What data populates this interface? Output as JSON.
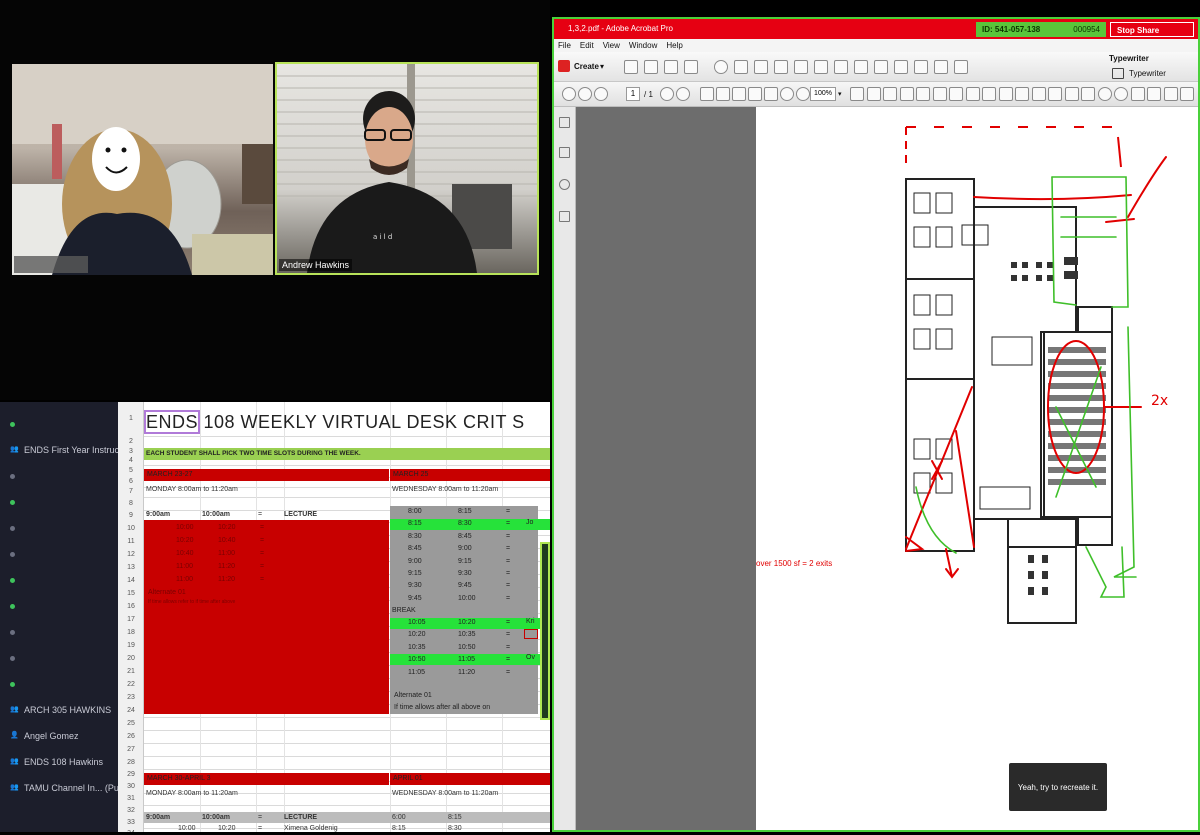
{
  "video": {
    "participants": [
      {
        "name": ""
      },
      {
        "name": "Andrew Hawkins"
      }
    ]
  },
  "sidebar": {
    "items": [
      {
        "label": "",
        "type": "status",
        "dot": "green"
      },
      {
        "label": "ENDS First Year Instructo...",
        "type": "team"
      },
      {
        "label": "",
        "type": "status",
        "dot": "gray"
      },
      {
        "label": "",
        "type": "status",
        "dot": "green"
      },
      {
        "label": "",
        "type": "status",
        "dot": "gray"
      },
      {
        "label": "",
        "type": "status",
        "dot": "gray"
      },
      {
        "label": "",
        "type": "status",
        "dot": "green"
      },
      {
        "label": "",
        "type": "status",
        "dot": "green"
      },
      {
        "label": "",
        "type": "status",
        "dot": "gray"
      },
      {
        "label": "",
        "type": "status",
        "dot": "gray"
      },
      {
        "label": "",
        "type": "status",
        "dot": "green"
      },
      {
        "label": "ARCH 305 HAWKINS",
        "type": "team"
      },
      {
        "label": "Angel Gomez",
        "type": "person"
      },
      {
        "label": "ENDS 108 Hawkins",
        "type": "team"
      },
      {
        "label": "TAMU Channel In... (Public)",
        "type": "team"
      }
    ]
  },
  "sheet": {
    "title": "ENDS 108 WEEKLY VIRTUAL DESK CRIT S",
    "title_sel": "ENDS",
    "subtitle": "EACH STUDENT SHALL PICK TWO TIME SLOTS DURING THE WEEK.",
    "week1_left": "MARCH 23-27",
    "week1_right": "MARCH 25",
    "row6_left": "MONDAY      8:00am to 11:20am",
    "row6_right": "WEDNESDAY 8:00am to 11:20am",
    "row8": {
      "a": "9:00am",
      "b": "10:00am",
      "c": "=",
      "d": "LECTURE"
    },
    "red_times": [
      [
        "10:00",
        "10:20",
        "="
      ],
      [
        "10:20",
        "10:40",
        "="
      ],
      [
        "10:40",
        "11:00",
        "="
      ],
      [
        "11:00",
        "11:20",
        "="
      ],
      [
        "11:00",
        "11:20",
        "="
      ]
    ],
    "alternate_left": "Alternate 01",
    "note_left": "If time allows refer to if time after above",
    "right_times": [
      [
        "8:00",
        "8:15",
        "="
      ],
      [
        "8:15",
        "8:30",
        "="
      ],
      [
        "8:30",
        "8:45",
        "="
      ],
      [
        "8:45",
        "9:00",
        "="
      ],
      [
        "9:00",
        "9:15",
        "="
      ],
      [
        "9:15",
        "9:30",
        "="
      ],
      [
        "9:30",
        "9:45",
        "="
      ],
      [
        "9:45",
        "10:00",
        "="
      ]
    ],
    "break_label": "BREAK",
    "right_times2": [
      [
        "10:05",
        "10:20",
        "="
      ],
      [
        "10:20",
        "10:35",
        "="
      ],
      [
        "10:35",
        "10:50",
        "="
      ],
      [
        "10:50",
        "11:05",
        "="
      ],
      [
        "11:05",
        "11:20",
        "="
      ]
    ],
    "alternate_right": "Alternate 01",
    "note_right": "If time allows after all above on",
    "week2_left": "MARCH 30-APRIL 3",
    "week2_right": "APRIL 01",
    "row31_left": "MONDAY      8:00am to 11:20am",
    "row31_right": "WEDNESDAY 8:00am to 11:20am",
    "row33": {
      "a": "9:00am",
      "b": "10:00am",
      "c": "=",
      "d": "LECTURE"
    },
    "row34": {
      "a": "10:00",
      "b": "10:20",
      "c": "=",
      "d": "Ximena Goldenig",
      "e": "8:15",
      "f": "8:30"
    },
    "right_cut_names": [
      "Jo",
      "Kri",
      "Ov"
    ],
    "row_numbers": [
      "1",
      "2",
      "3",
      "4",
      "5",
      "6",
      "7",
      "8",
      "9",
      "10",
      "11",
      "12",
      "13",
      "14",
      "15",
      "16",
      "17",
      "18",
      "19",
      "20",
      "21",
      "22",
      "23",
      "24",
      "25",
      "26",
      "27",
      "28",
      "29",
      "30",
      "31",
      "32",
      "33",
      "34"
    ]
  },
  "acrobat": {
    "window_title": "1,3,2.pdf - Adobe Acrobat Pro",
    "share_id": "ID: 541-057-138",
    "share_timer": "000954",
    "stop_share": "Stop Share",
    "menu": [
      "File",
      "Edit",
      "View",
      "Window",
      "Help"
    ],
    "create_label": "Create",
    "typewriter_title": "Typewriter",
    "typewriter_button": "Typewriter",
    "page_current": "1",
    "page_total": "/ 1",
    "zoom": "100%",
    "annotation_note": "over 1500 sf = 2 exits",
    "annotation_2x": "2x",
    "toast": "Yeah, try to recreate it."
  },
  "colors": {
    "acrobat_red": "#e60012",
    "share_green": "#5ac53a",
    "sheet_red": "#c80000",
    "sheet_green": "#26e23a",
    "markup_red": "#e10000",
    "markup_green": "#3fbf2a"
  }
}
